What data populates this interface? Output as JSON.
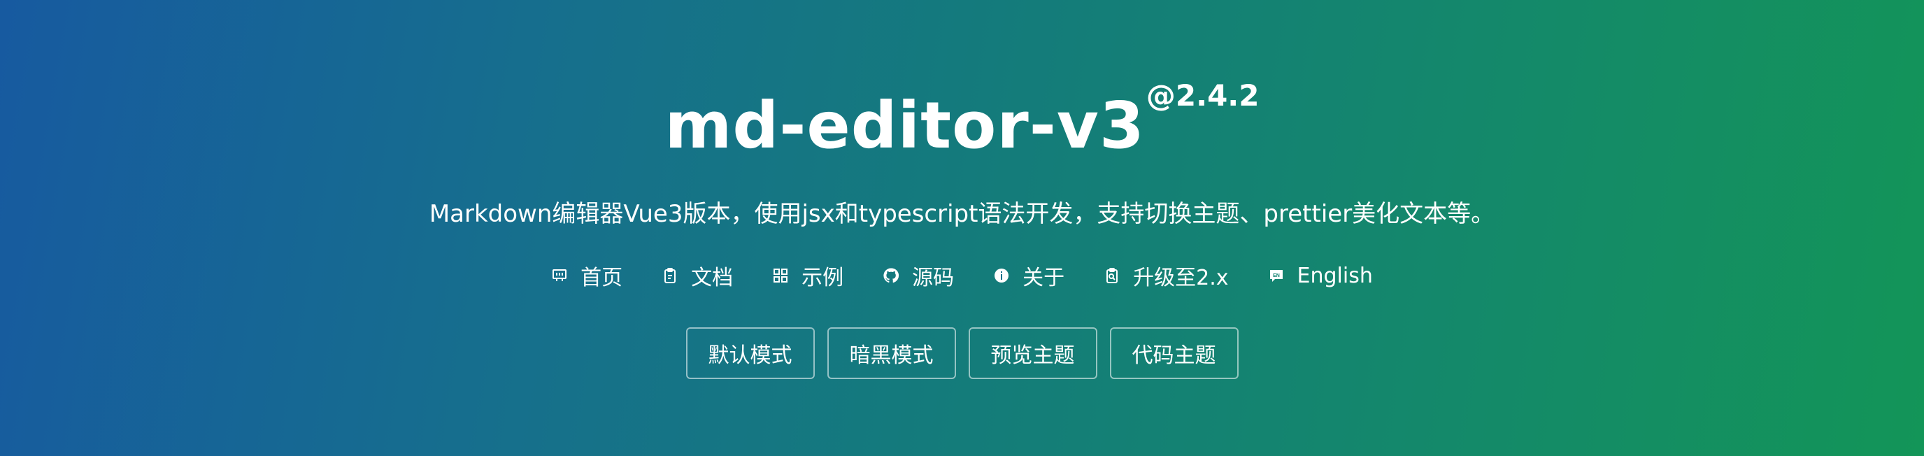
{
  "header": {
    "title": "md-editor-v3",
    "version": "@2.4.2",
    "description": "Markdown编辑器Vue3版本，使用jsx和typescript语法开发，支持切换主题、prettier美化文本等。"
  },
  "nav": {
    "items": [
      {
        "label": "首页",
        "icon": "home-icon"
      },
      {
        "label": "文档",
        "icon": "clipboard-icon"
      },
      {
        "label": "示例",
        "icon": "grid-icon"
      },
      {
        "label": "源码",
        "icon": "github-icon"
      },
      {
        "label": "关于",
        "icon": "info-icon"
      },
      {
        "label": "升级至2.x",
        "icon": "upgrade-icon"
      },
      {
        "label": "English",
        "icon": "language-icon"
      }
    ]
  },
  "buttons": {
    "default_mode": "默认模式",
    "dark_mode": "暗黑模式",
    "preview_theme": "预览主题",
    "code_theme": "代码主题"
  }
}
